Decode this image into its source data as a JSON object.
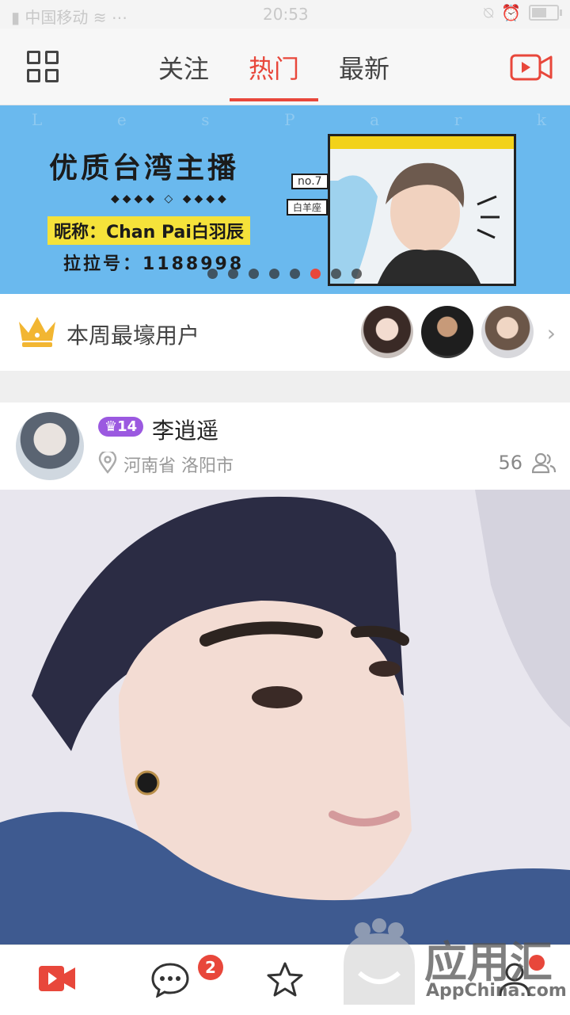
{
  "status_bar": {
    "carrier": "中国移动",
    "time": "20:53"
  },
  "nav": {
    "tabs": [
      {
        "label": "关注",
        "active": false
      },
      {
        "label": "热门",
        "active": true
      },
      {
        "label": "最新",
        "active": false
      }
    ],
    "accent_color": "#e8473b"
  },
  "banner": {
    "watermark_letters": [
      "L",
      "e",
      "s",
      "P",
      "a",
      "r",
      "k"
    ],
    "headline": "优质台湾主播",
    "nickname": "昵称：Chan Pai白羽辰",
    "lala_id": "拉拉号：1188998",
    "rank_tag": "no.7",
    "sign_tag": "白羊座",
    "page_count": 8,
    "active_page": 6
  },
  "weekly_users": {
    "label": "本周最壕用户",
    "avatar_count": 3
  },
  "post": {
    "level": "14",
    "username": "李逍遥",
    "location": "河南省 洛阳市",
    "viewers": "56"
  },
  "bottom_nav": {
    "messages_badge": "2"
  },
  "watermark": {
    "title": "应用汇",
    "subtitle": "AppChina.com"
  }
}
